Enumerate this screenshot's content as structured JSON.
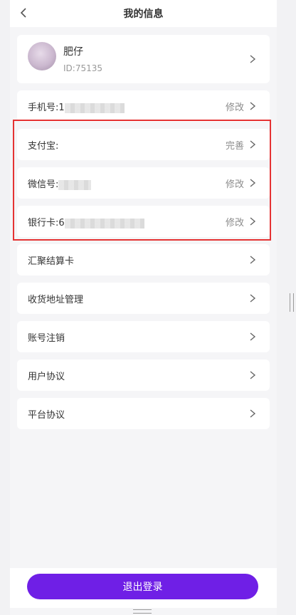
{
  "header": {
    "title": "我的信息"
  },
  "profile": {
    "name": "肥仔",
    "id": "ID:75135"
  },
  "menu": {
    "phone": {
      "label": "手机号:1",
      "action": "修改"
    },
    "alipay": {
      "label": "支付宝:",
      "action": "完善"
    },
    "wechat": {
      "label": "微信号:",
      "action": "修改"
    },
    "bankcard": {
      "label": "银行卡:6",
      "action": "修改"
    },
    "settlement_card": {
      "label": "汇聚结算卡"
    },
    "address": {
      "label": "收货地址管理"
    },
    "cancel_account": {
      "label": "账号注销"
    },
    "user_agreement": {
      "label": "用户协议"
    },
    "platform_agreement": {
      "label": "平台协议"
    }
  },
  "footer": {
    "logout_label": "退出登录"
  },
  "colors": {
    "accent": "#6f1fe6",
    "highlight": "#e53333"
  },
  "icons": {
    "back": "chevron-left-icon",
    "row": "chevron-right-icon"
  }
}
